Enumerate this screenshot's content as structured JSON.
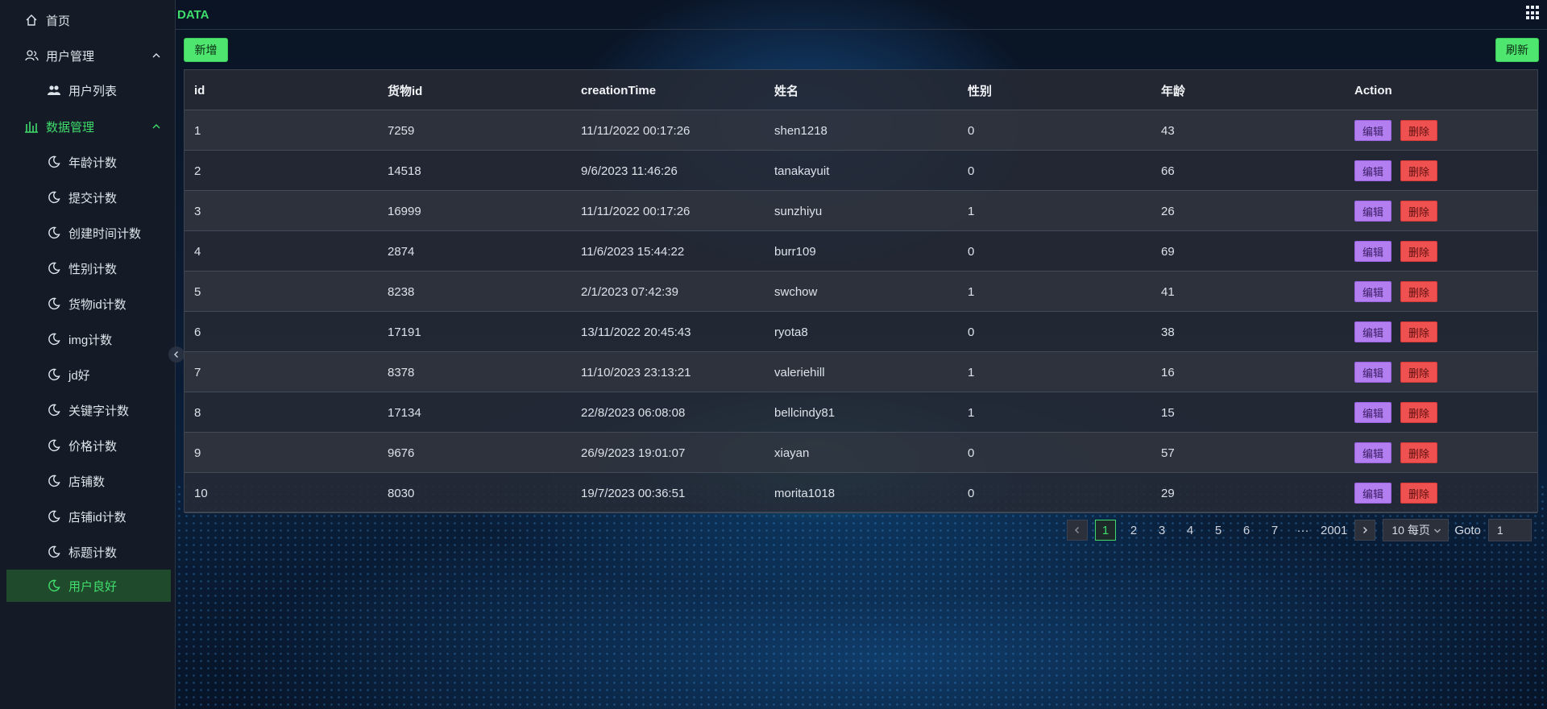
{
  "app": {
    "brand": "DATA"
  },
  "sidebar": {
    "home": "首页",
    "user_mgmt": "用户管理",
    "user_list": "用户列表",
    "data_mgmt": "数据管理",
    "items": [
      "年龄计数",
      "提交计数",
      "创建时间计数",
      "性别计数",
      "货物id计数",
      "img计数",
      "jd好",
      "关键字计数",
      "价格计数",
      "店铺数",
      "店铺id计数",
      "标题计数",
      "用户良好"
    ],
    "active_item": "用户良好"
  },
  "toolbar": {
    "add_label": "新增",
    "refresh_label": "刷新"
  },
  "table": {
    "headers": [
      "id",
      "货物id",
      "creationTime",
      "姓名",
      "性别",
      "年龄",
      "Action"
    ],
    "rows": [
      [
        "1",
        "7259",
        "11/11/2022 00:17:26",
        "shen1218",
        "0",
        "43"
      ],
      [
        "2",
        "14518",
        "9/6/2023 11:46:26",
        "tanakayuit",
        "0",
        "66"
      ],
      [
        "3",
        "16999",
        "11/11/2022 00:17:26",
        "sunzhiyu",
        "1",
        "26"
      ],
      [
        "4",
        "2874",
        "11/6/2023 15:44:22",
        "burr109",
        "0",
        "69"
      ],
      [
        "5",
        "8238",
        "2/1/2023 07:42:39",
        "swchow",
        "1",
        "41"
      ],
      [
        "6",
        "17191",
        "13/11/2022 20:45:43",
        "ryota8",
        "0",
        "38"
      ],
      [
        "7",
        "8378",
        "11/10/2023 23:13:21",
        "valeriehill",
        "1",
        "16"
      ],
      [
        "8",
        "17134",
        "22/8/2023 06:08:08",
        "bellcindy81",
        "1",
        "15"
      ],
      [
        "9",
        "9676",
        "26/9/2023 19:01:07",
        "xiayan",
        "0",
        "57"
      ],
      [
        "10",
        "8030",
        "19/7/2023 00:36:51",
        "morita1018",
        "0",
        "29"
      ]
    ],
    "edit_label": "编辑",
    "delete_label": "删除"
  },
  "pagination": {
    "pages": [
      "1",
      "2",
      "3",
      "4",
      "5",
      "6",
      "7"
    ],
    "ellipsis": "···",
    "last_page": "2001",
    "current_page": "1",
    "page_size_label": "10 每页",
    "goto_label": "Goto",
    "goto_value": "1"
  },
  "colors": {
    "accent": "#3fdc6c",
    "edit": "#b27ef0",
    "delete": "#ef5050"
  }
}
